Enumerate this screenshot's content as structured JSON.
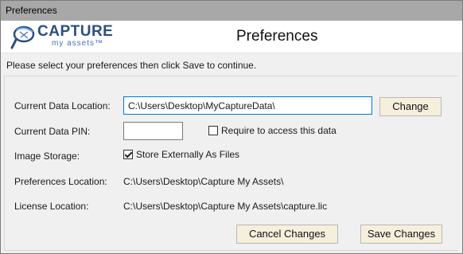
{
  "window": {
    "title": "Preferences"
  },
  "header": {
    "logo_brand": "CAPTURE",
    "logo_sub": "my assets™",
    "title": "Preferences"
  },
  "instructions": "Please select your preferences then click Save to continue.",
  "form": {
    "data_location_label": "Current Data Location:",
    "data_location_value": "C:\\Users\\Desktop\\MyCaptureData\\",
    "change_button": "Change",
    "pin_label": "Current Data PIN:",
    "pin_value": "",
    "require_label": "Require to access this data",
    "require_checked": false,
    "storage_label": "Image Storage:",
    "store_files_label": "Store Externally As Files",
    "store_files_checked": true,
    "prefs_location_label": "Preferences Location:",
    "prefs_location_value": "C:\\Users\\Desktop\\Capture My Assets\\",
    "license_location_label": "License Location:",
    "license_location_value": "C:\\Users\\Desktop\\Capture My Assets\\capture.lic"
  },
  "buttons": {
    "cancel": "Cancel Changes",
    "save": "Save Changes"
  },
  "colors": {
    "accent": "#0078d7",
    "button_bg": "#f5efdc",
    "logo_blue": "#2d4f7f"
  }
}
